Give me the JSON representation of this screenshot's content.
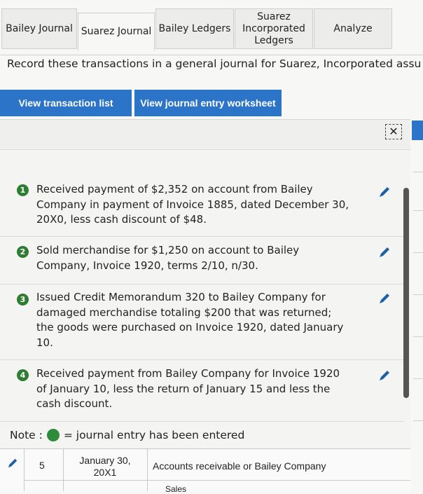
{
  "tabs": [
    {
      "label": "Bailey Journal"
    },
    {
      "label": "Suarez Journal"
    },
    {
      "label": "Bailey Ledgers"
    },
    {
      "label": "Suarez Incorporated Ledgers"
    },
    {
      "label": "Analyze"
    }
  ],
  "instruction": "Record these transactions in a general journal for Suarez, Incorporated assu",
  "buttons": {
    "transaction_list": "View transaction list",
    "journal_worksheet": "View journal entry worksheet"
  },
  "close_symbol": "✕",
  "transactions": [
    {
      "number": "1",
      "text": "Received payment of $2,352 on account from Bailey Company in payment of Invoice 1885, dated December 30, 20X0, less cash discount of $48."
    },
    {
      "number": "2",
      "text": "Sold merchandise for $1,250 on account to Bailey Company, Invoice 1920, terms 2/10, n/30."
    },
    {
      "number": "3",
      "text": "Issued Credit Memorandum 320 to Bailey Company for damaged merchandise totaling $200 that was returned; the goods were purchased on Invoice 1920, dated January 10."
    },
    {
      "number": "4",
      "text": "Received payment from Bailey Company for Invoice 1920 of January 10, less the return of January 15 and less the cash discount."
    }
  ],
  "note": {
    "label": "Note :",
    "text": "= journal entry has been entered"
  },
  "journal_row": {
    "no": "5",
    "date_line1": "January 30,",
    "date_line2": "20X1",
    "account": "Accounts receivable or Bailey Company",
    "next_account": "Sales"
  },
  "colors": {
    "accent": "#2b74c7",
    "entered": "#2e8b3a"
  }
}
